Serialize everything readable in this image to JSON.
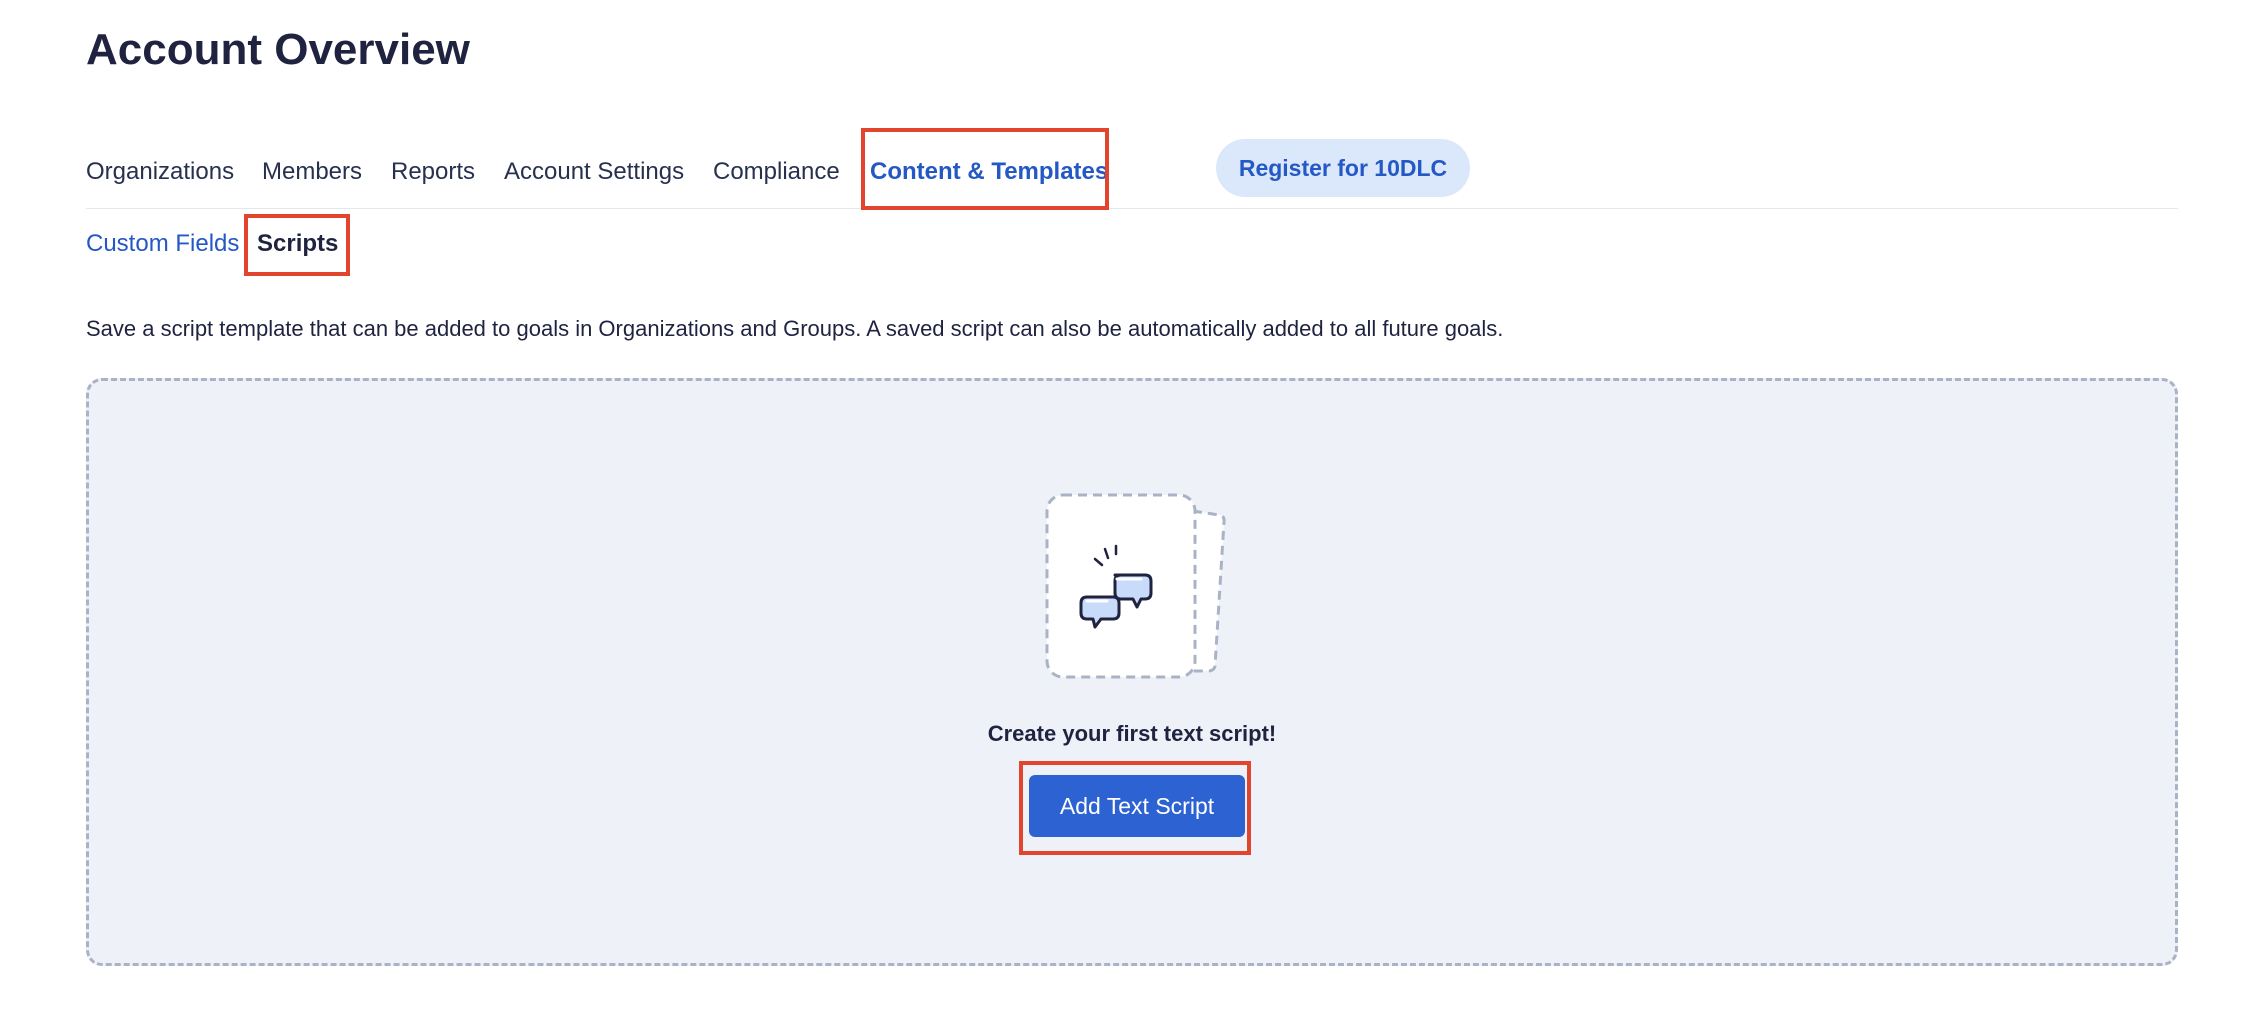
{
  "page": {
    "title": "Account Overview"
  },
  "main_tabs": [
    {
      "label": "Organizations",
      "active": false
    },
    {
      "label": "Members",
      "active": false
    },
    {
      "label": "Reports",
      "active": false
    },
    {
      "label": "Account Settings",
      "active": false
    },
    {
      "label": "Compliance",
      "active": false
    },
    {
      "label": "Content & Templates",
      "active": true
    }
  ],
  "register_button": {
    "label": "Register for 10DLC"
  },
  "sub_tabs": [
    {
      "label": "Custom Fields",
      "active": false
    },
    {
      "label": "Scripts",
      "active": true
    }
  ],
  "description": "Save a script template that can be added to goals in Organizations and Groups. A saved script can also be automatically added to all future goals.",
  "empty_state": {
    "title": "Create your first text script!",
    "button_label": "Add Text Script",
    "icon": "chat-bubbles-icon"
  },
  "colors": {
    "accent": "#2458c5",
    "button": "#2d62d3",
    "highlight": "#e1452e",
    "panel_bg": "#eef1f8"
  }
}
